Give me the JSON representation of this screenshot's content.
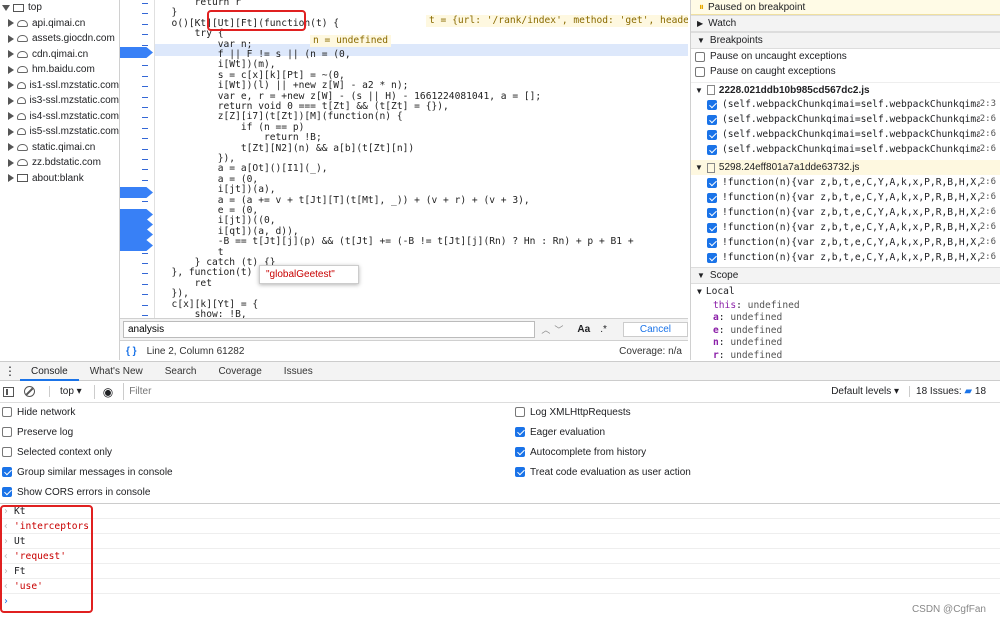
{
  "tree": {
    "root": "top",
    "items": [
      "api.qimai.cn",
      "assets.giocdn.com",
      "cdn.qimai.cn",
      "hm.baidu.com",
      "is1-ssl.mzstatic.com",
      "is3-ssl.mzstatic.com",
      "is4-ssl.mzstatic.com",
      "is5-ssl.mzstatic.com",
      "static.qimai.cn",
      "zz.bdstatic.com"
    ],
    "blank": "about:blank"
  },
  "code": {
    "lines": [
      "      return r",
      "  }",
      "  o()[Kt][Ut][Ft](function(t) {",
      "      try {",
      "          var n;",
      "          f || F != s || (n = (0,",
      "          i[Wt])(m),",
      "          s = c[x][k][Pt] = ~(0,",
      "          i[Wt])(l) || +new z[W] - a2 * n);",
      "          var e, r = +new z[W] - (s || H) - 1661224081041, a = [];",
      "          return void 0 === t[Zt] && (t[Zt] = {}),",
      "          z[Z][i7](t[Zt])[M](function(n) {",
      "              if (n == p)",
      "                  return !B;",
      "              t[Zt][N2](n) && a[b](t[Zt][n])",
      "          }),",
      "          a = a[Ot]()[I1](_),",
      "          a = (0,",
      "          i[jt])(a),",
      "          a = (a += v + t[Jt][T](t[Mt], _)) + (v + r) + (v + 3),",
      "          e = (0,",
      "          i[jt])((0,",
      "          i[qt])(a, d)),",
      "          -B == t[Jt][j](p) && (t[Jt] += (-B != t[Jt][j](Rn) ? Hn : Rn) + p + B1 +",
      "          t",
      "      } catch (t) {}",
      "  }, function(t) {",
      "      ret",
      "  }),",
      "  c[x][k][Yt] = {",
      "      show: !B,",
      "      count: H"
    ],
    "inline_t": "t = {url: '/rank/index', method: 'get', headers: {…},",
    "inline_n": "n = undefined",
    "tooltip": "\"globalGeetest\""
  },
  "search": {
    "value": "analysis",
    "aa": "Aa",
    "regex": ".*",
    "cancel": "Cancel"
  },
  "status": {
    "position": "Line 2, Column 61282",
    "coverage": "Coverage: n/a"
  },
  "debugger": {
    "paused": "Paused on breakpoint",
    "watch": "Watch",
    "breakpoints": "Breakpoints",
    "pause_uncaught": "Pause on uncaught exceptions",
    "pause_caught": "Pause on caught exceptions",
    "file1": "2228.021ddb10b985cd567dc2.js",
    "file1_entries": [
      "(self.webpackChunkqimai=self.webpackChunkqima…",
      "(self.webpackChunkqimai=self.webpackChunkqima…",
      "(self.webpackChunkqimai=self.webpackChunkqima…",
      "(self.webpackChunkqimai=self.webpackChunkqima…"
    ],
    "file1_lines": [
      "2:3",
      "2:6",
      "2:6",
      "2:6"
    ],
    "file2": "5298.24eff801a7a1dde63732.js",
    "file2_entries": [
      "!function(n){var z,b,t,e,C,Y,A,k,x,P,R,B,H,X,…",
      "!function(n){var z,b,t,e,C,Y,A,k,x,P,R,B,H,X,…",
      "!function(n){var z,b,t,e,C,Y,A,k,x,P,R,B,H,X,…",
      "!function(n){var z,b,t,e,C,Y,A,k,x,P,R,B,H,X,…",
      "!function(n){var z,b,t,e,C,Y,A,k,x,P,R,B,H,X,…",
      "!function(n){var z,b,t,e,C,Y,A,k,x,P,R,B,H,X,…"
    ],
    "file2_lines": [
      "2:6",
      "2:6",
      "2:6",
      "2:6",
      "2:6",
      "2:6"
    ],
    "scope": "Scope",
    "local": "Local",
    "vars": [
      {
        "k": "this",
        "v": "undefined"
      },
      {
        "k": "a",
        "v": "undefined"
      },
      {
        "k": "e",
        "v": "undefined"
      },
      {
        "k": "n",
        "v": "undefined"
      },
      {
        "k": "r",
        "v": "undefined"
      }
    ],
    "t_label": "t:"
  },
  "drawer": {
    "tabs": [
      "Console",
      "What's New",
      "Search",
      "Coverage",
      "Issues"
    ],
    "context": "top",
    "filter_placeholder": "Filter",
    "levels": "Default levels ▾",
    "issues": "18 Issues:",
    "issues_count": "18"
  },
  "settings": {
    "left": [
      {
        "label": "Hide network",
        "on": false
      },
      {
        "label": "Preserve log",
        "on": false
      },
      {
        "label": "Selected context only",
        "on": false
      },
      {
        "label": "Group similar messages in console",
        "on": true
      },
      {
        "label": "Show CORS errors in console",
        "on": true
      }
    ],
    "right": [
      {
        "label": "Log XMLHttpRequests",
        "on": false
      },
      {
        "label": "Eager evaluation",
        "on": true
      },
      {
        "label": "Autocomplete from history",
        "on": true
      },
      {
        "label": "Treat code evaluation as user action",
        "on": true
      }
    ]
  },
  "console": [
    {
      "text": "Kt",
      "type": "input"
    },
    {
      "text": "'interceptors'",
      "type": "output"
    },
    {
      "text": "Ut",
      "type": "input"
    },
    {
      "text": "'request'",
      "type": "output"
    },
    {
      "text": "Ft",
      "type": "input"
    },
    {
      "text": "'use'",
      "type": "output"
    }
  ],
  "watermark": "CSDN @CgfFan"
}
